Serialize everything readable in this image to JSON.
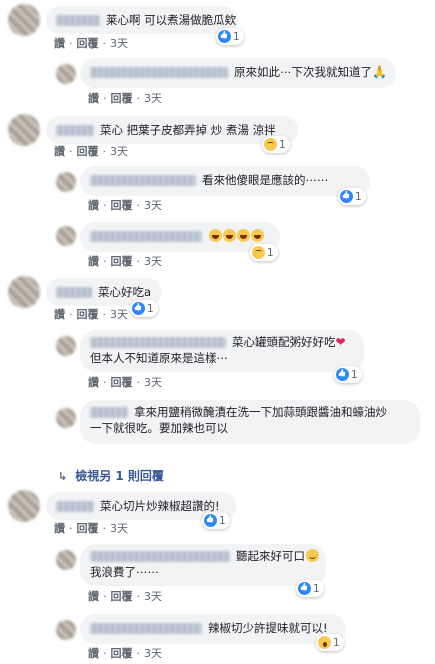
{
  "action_labels": {
    "like": "讚",
    "reply": "回覆",
    "time": "3天",
    "sep": "·"
  },
  "comments": [
    {
      "text": "莱心啊 可以煮湯做脆瓜欸",
      "reaction_count": "1"
    },
    {
      "text": "原來如此⋯下次我就知道了",
      "emoji": "🙏"
    },
    {
      "text": "菜心 把葉子皮都弄掉 炒 煮湯 涼拌",
      "reaction_count": "1"
    },
    {
      "text": "看來他傻眼是應該的⋯⋯",
      "reaction_count": "1"
    },
    {
      "reaction_count": "1"
    },
    {
      "text": "菜心好吃a",
      "reaction_count": "1"
    },
    {
      "text_line1": "菜心罐頭配粥好好吃",
      "text_line2": "但本人不知道原來是這樣⋯",
      "reaction_count": "1"
    },
    {
      "text_line1": "拿來用鹽稍微醃漬在洗一下加蒜頭跟醬油和蠔油炒",
      "text_line2": "一下就很吃。要加辣也可以"
    },
    {
      "text": "菜心切片炒辣椒超讚的!",
      "reaction_count": "1"
    },
    {
      "text": "聽起來好可口",
      "text_line2": "我浪費了⋯⋯",
      "reaction_count": "1"
    },
    {
      "text": "辣椒切少許提味就可以!",
      "reaction_count": "1"
    }
  ],
  "more_replies": "檢視另 1 則回覆",
  "colors": {
    "bubble": "#f2f3f5",
    "link": "#385898",
    "meta": "#606770",
    "like": "#2d88ff"
  }
}
